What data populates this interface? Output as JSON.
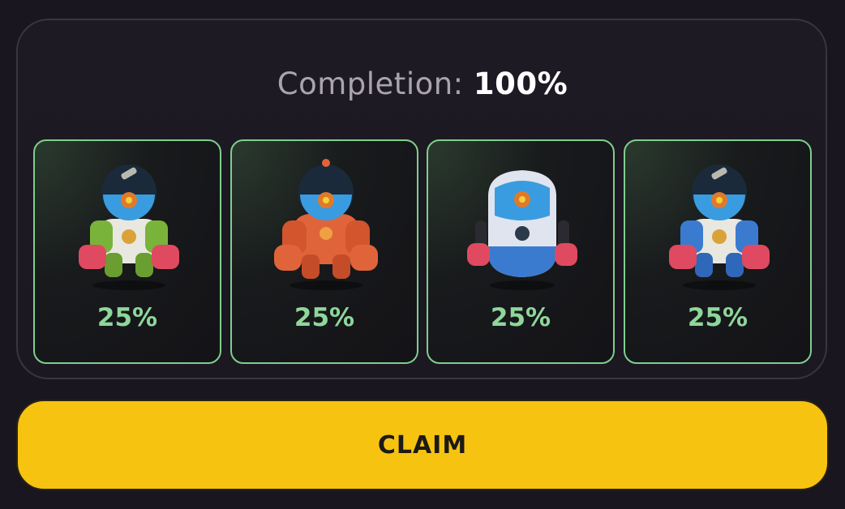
{
  "completion": {
    "label": "Completion:",
    "value": "100%"
  },
  "cards": [
    {
      "percent": "25%",
      "icon": "green-robot-icon",
      "color": "#7ab33a"
    },
    {
      "percent": "25%",
      "icon": "orange-robot-icon",
      "color": "#e0643a"
    },
    {
      "percent": "25%",
      "icon": "white-robot-icon",
      "color": "#dfe4ee"
    },
    {
      "percent": "25%",
      "icon": "blue-robot-icon",
      "color": "#3a7bd0"
    }
  ],
  "claim_button": {
    "label": "CLAIM",
    "color": "#f7c311"
  },
  "colors": {
    "background": "#1a1620",
    "card_border": "#7fcf8c",
    "percent_text": "#8fd69a"
  }
}
